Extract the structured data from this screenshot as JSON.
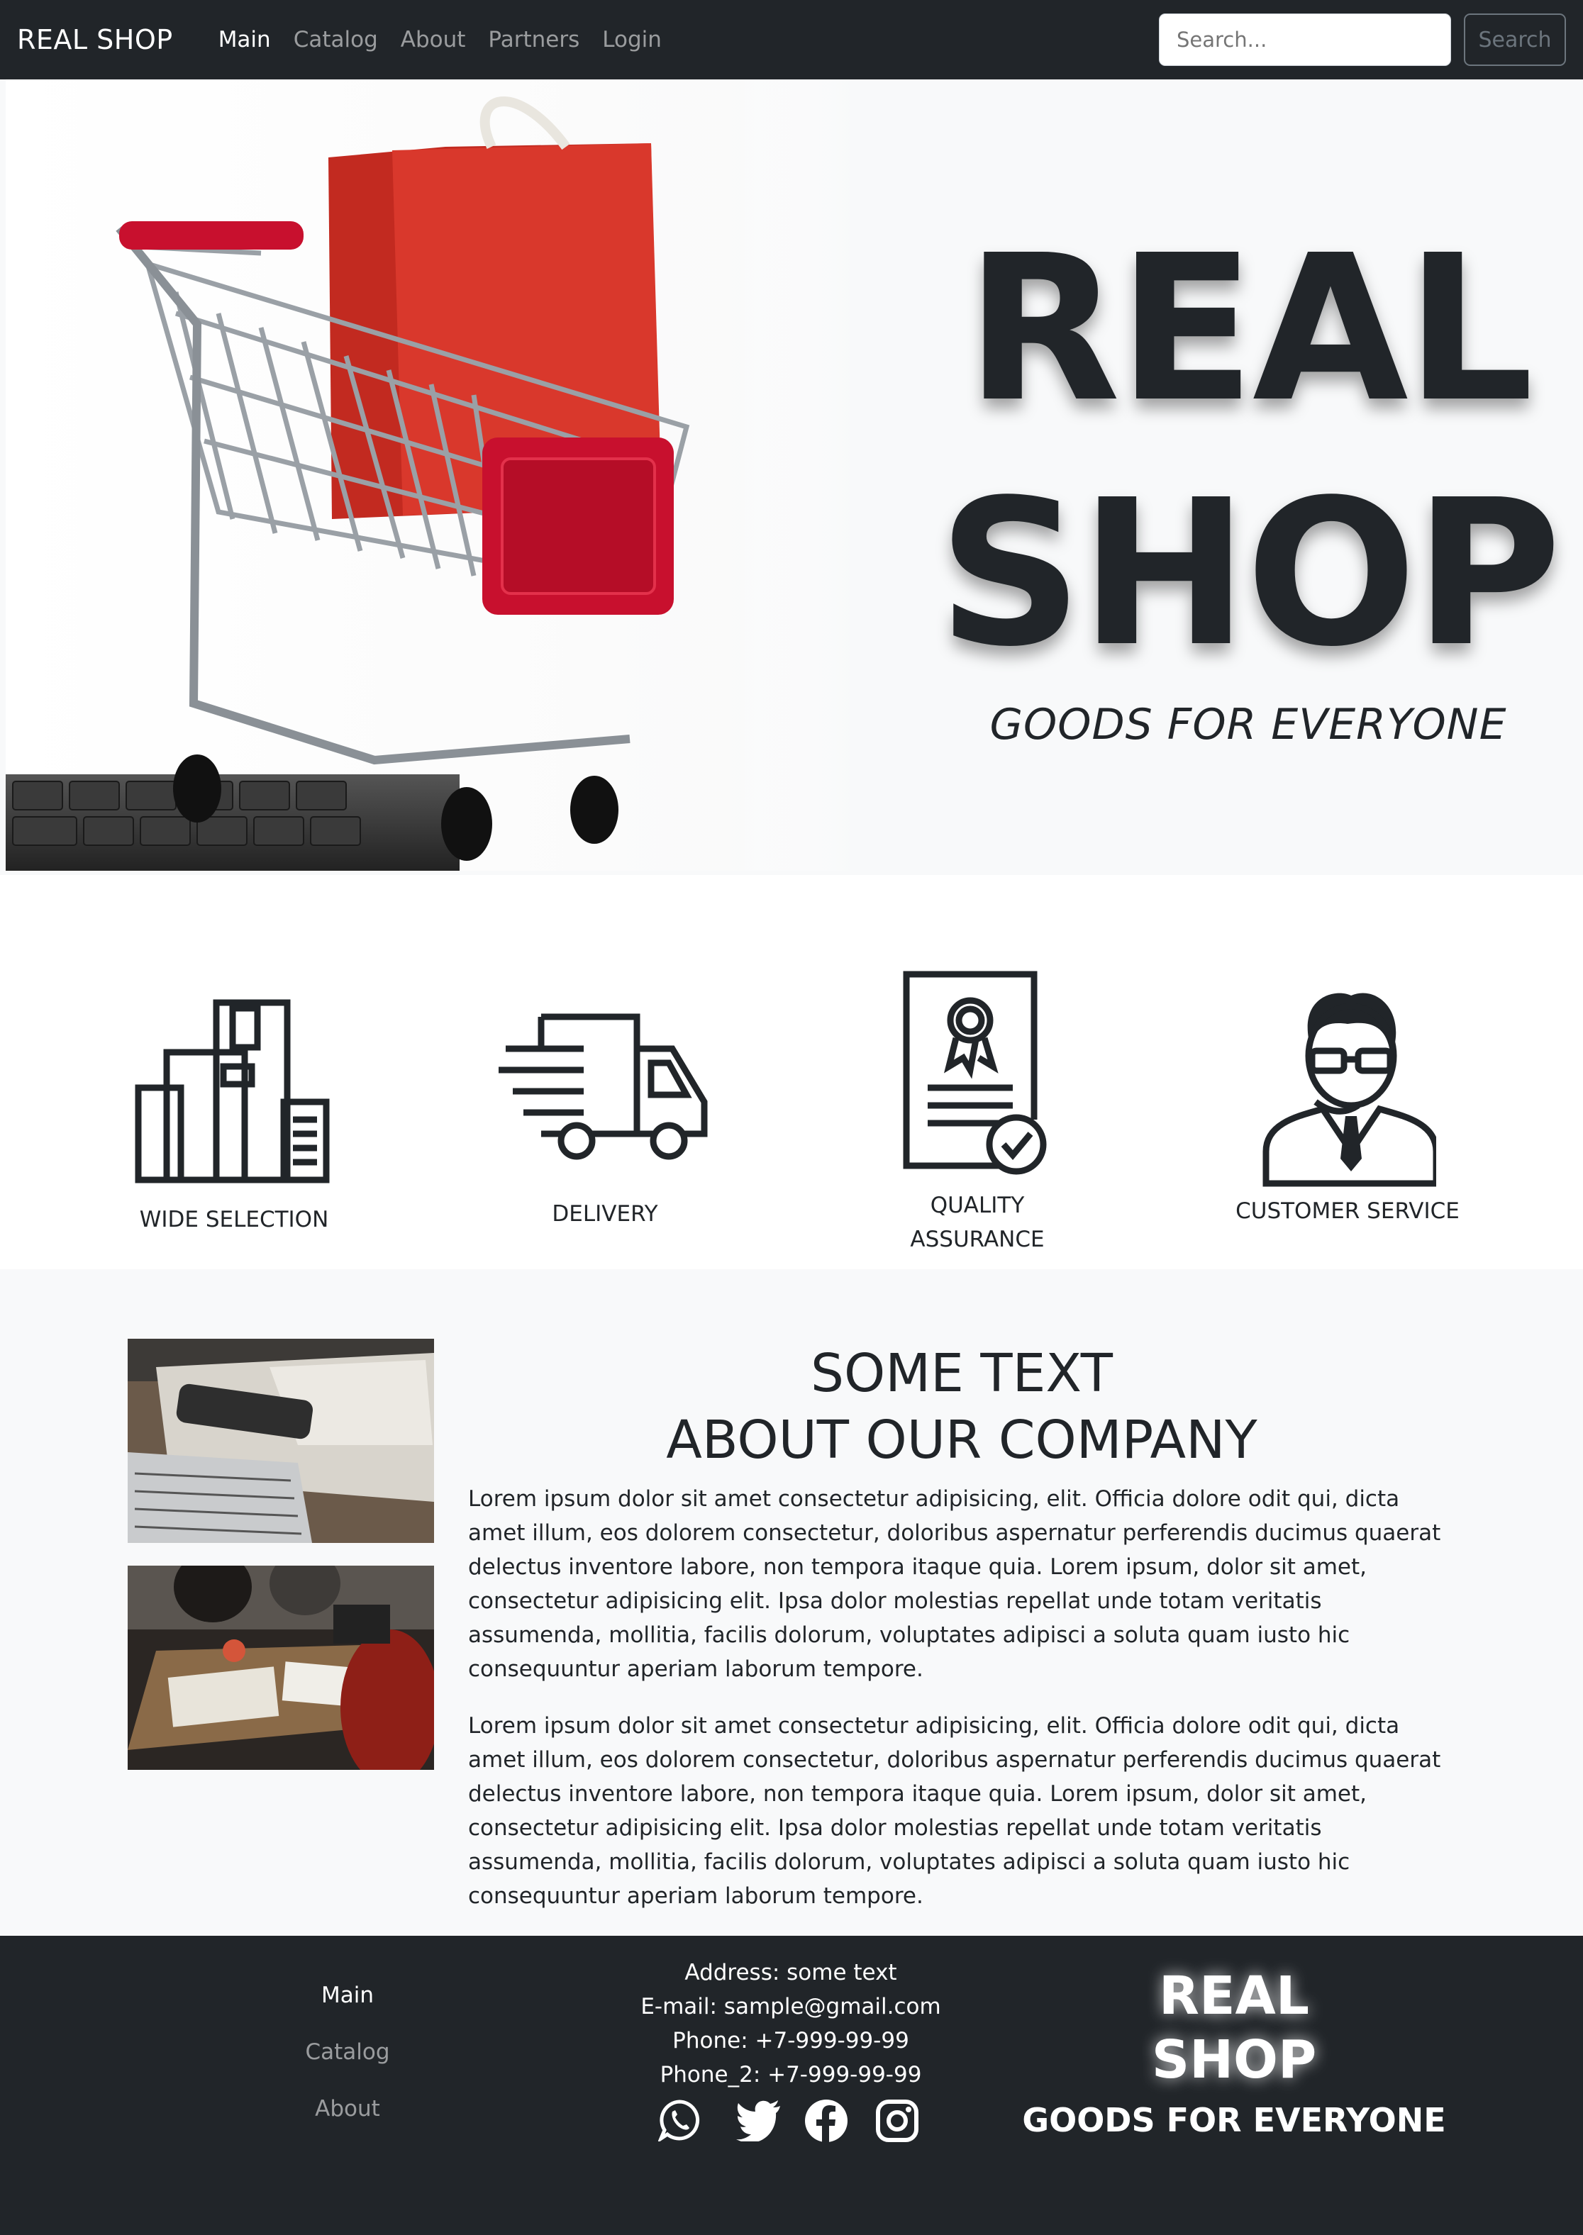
{
  "nav": {
    "brand": "REAL SHOP",
    "links": [
      {
        "label": "Main"
      },
      {
        "label": "Catalog"
      },
      {
        "label": "About"
      },
      {
        "label": "Partners"
      },
      {
        "label": "Login"
      }
    ],
    "search_placeholder": "Search...",
    "search_button": "Search"
  },
  "hero": {
    "title_line1": "REAL",
    "title_line2": "SHOP",
    "subtitle": "GOODS FOR EVERYONE"
  },
  "features": [
    {
      "label": "WIDE SELECTION",
      "icon": "boxes-icon"
    },
    {
      "label": "DELIVERY",
      "icon": "truck-icon"
    },
    {
      "label_line1": "QUALITY",
      "label_line2": "ASSURANCE",
      "icon": "certificate-icon"
    },
    {
      "label": "CUSTOMER SERVICE",
      "icon": "support-agent-icon"
    }
  ],
  "about": {
    "title_line1": "SOME TEXT",
    "title_line2": "ABOUT OUR COMPANY",
    "paragraphs": [
      "Lorem ipsum dolor sit amet consectetur adipisicing, elit. Officia dolore odit qui, dicta amet illum, eos dolorem consectetur, doloribus aspernatur perferendis ducimus quaerat delectus inventore labore, non tempora itaque quia. Lorem ipsum, dolor sit amet, consectetur adipisicing elit. Ipsa dolor molestias repellat unde totam veritatis assumenda, mollitia, facilis dolorum, voluptates adipisci a soluta quam iusto hic consequuntur aperiam laborum tempore.",
      "Lorem ipsum dolor sit amet consectetur adipisicing, elit. Officia dolore odit qui, dicta amet illum, eos dolorem consectetur, doloribus aspernatur perferendis ducimus quaerat delectus inventore labore, non tempora itaque quia. Lorem ipsum, dolor sit amet, consectetur adipisicing elit. Ipsa dolor molestias repellat unde totam veritatis assumenda, mollitia, facilis dolorum, voluptates adipisci a soluta quam iusto hic consequuntur aperiam laborum tempore."
    ]
  },
  "footer": {
    "links": [
      {
        "label": "Main"
      },
      {
        "label": "Catalog"
      },
      {
        "label": "About"
      }
    ],
    "address": "Address: some text",
    "email": "E-mail: sample@gmail.com",
    "phone": "Phone: +7-999-99-99",
    "phone2": "Phone_2: +7-999-99-99",
    "social_icons": [
      "whatsapp-icon",
      "twitter-icon",
      "facebook-icon",
      "instagram-icon"
    ],
    "logo_line1": "REAL",
    "logo_line2": "SHOP",
    "logo_sub": "GOODS FOR EVERYONE"
  },
  "colors": {
    "dark": "#212529",
    "light_bg": "#f8f9fa",
    "muted": "#6c757d",
    "accent_red": "#d62f24"
  }
}
